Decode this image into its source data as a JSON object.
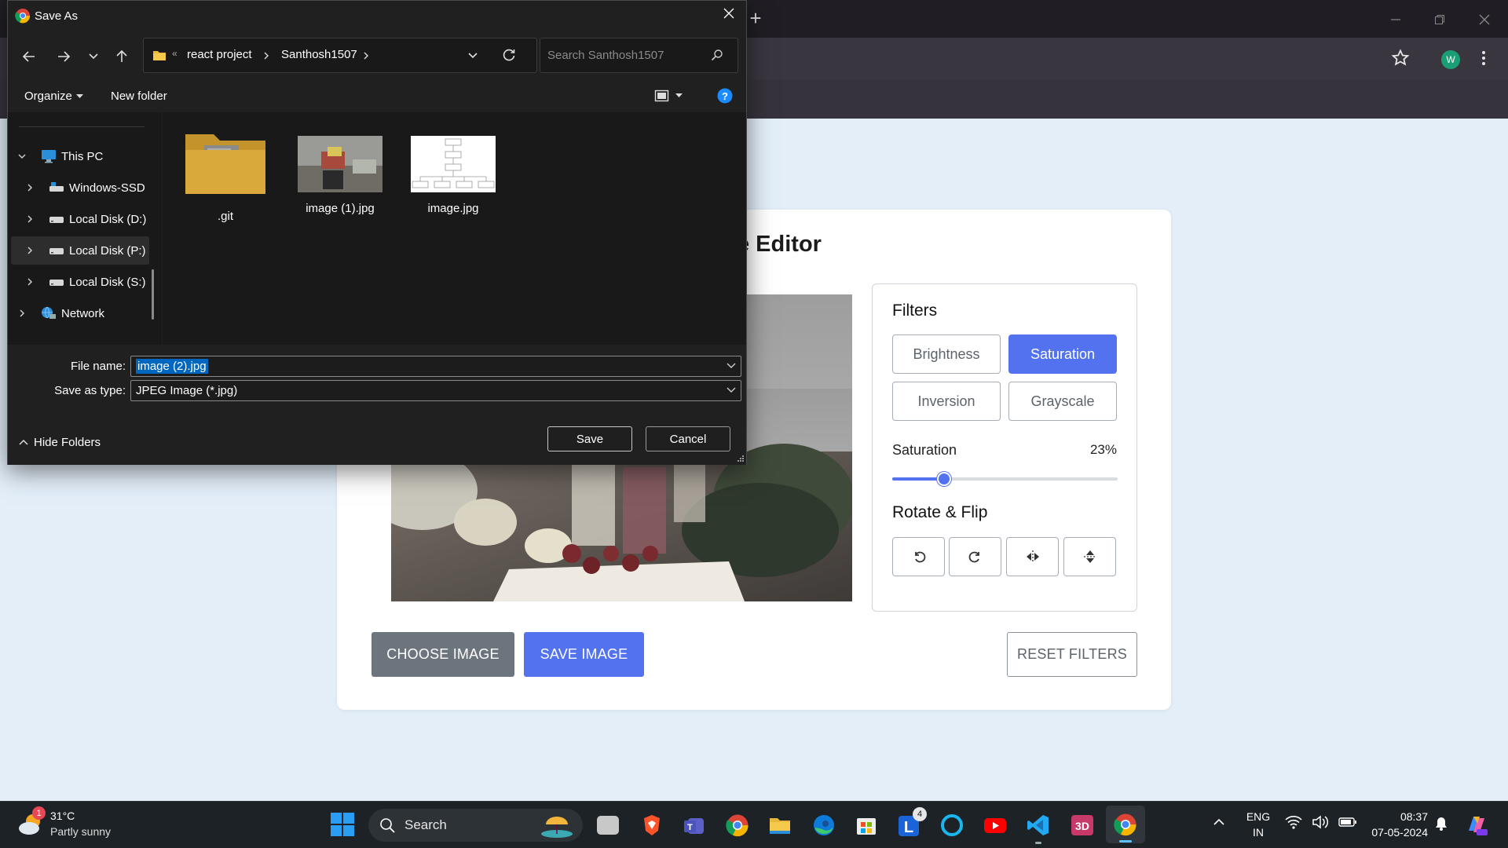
{
  "browser": {
    "new_tab_symbol": "+",
    "profile_initial": "W"
  },
  "editor": {
    "title": "e Editor",
    "filters_title": "Filters",
    "filter_buttons": [
      "Brightness",
      "Saturation",
      "Inversion",
      "Grayscale"
    ],
    "active_filter": "Saturation",
    "slider_label": "Saturation",
    "slider_value_text": "23%",
    "slider_fraction": 0.23,
    "rotate_title": "Rotate & Flip",
    "rotate_icons": [
      "rotate-left-icon",
      "rotate-right-icon",
      "flip-horizontal-icon",
      "flip-vertical-icon"
    ],
    "choose_label": "CHOOSE IMAGE",
    "save_label": "SAVE IMAGE",
    "reset_label": "RESET FILTERS",
    "colors": {
      "accent": "#5372ef",
      "choose_bg": "#6c757d"
    }
  },
  "dialog": {
    "title": "Save As",
    "address": {
      "overflow": "«",
      "crumbs": [
        "react project",
        "Santhosh1507"
      ]
    },
    "search_placeholder": "Search Santhosh1507",
    "organize_label": "Organize",
    "new_folder_label": "New folder",
    "tree": [
      {
        "label": "This PC",
        "level": 0,
        "expanded": true
      },
      {
        "label": "Windows-SSD",
        "level": 1
      },
      {
        "label": "Local Disk (D:)",
        "level": 1
      },
      {
        "label": "Local Disk (P:)",
        "level": 1,
        "selected": true
      },
      {
        "label": "Local Disk (S:)",
        "level": 1
      },
      {
        "label": "Network",
        "level": 0
      }
    ],
    "files": [
      ".git",
      "image (1).jpg",
      "image.jpg"
    ],
    "file_name_label": "File name:",
    "file_name_value": "image (2).jpg",
    "save_type_label": "Save as type:",
    "save_type_value": "JPEG Image (*.jpg)",
    "hide_folders_label": "Hide Folders",
    "save_button": "Save",
    "cancel_button": "Cancel"
  },
  "taskbar": {
    "weather_temp": "31°C",
    "weather_desc": "Partly sunny",
    "weather_badge": "1",
    "search_label": "Search",
    "lang_1": "ENG",
    "lang_2": "IN",
    "time": "08:37",
    "date": "07-05-2024",
    "notification_badge": "4"
  }
}
